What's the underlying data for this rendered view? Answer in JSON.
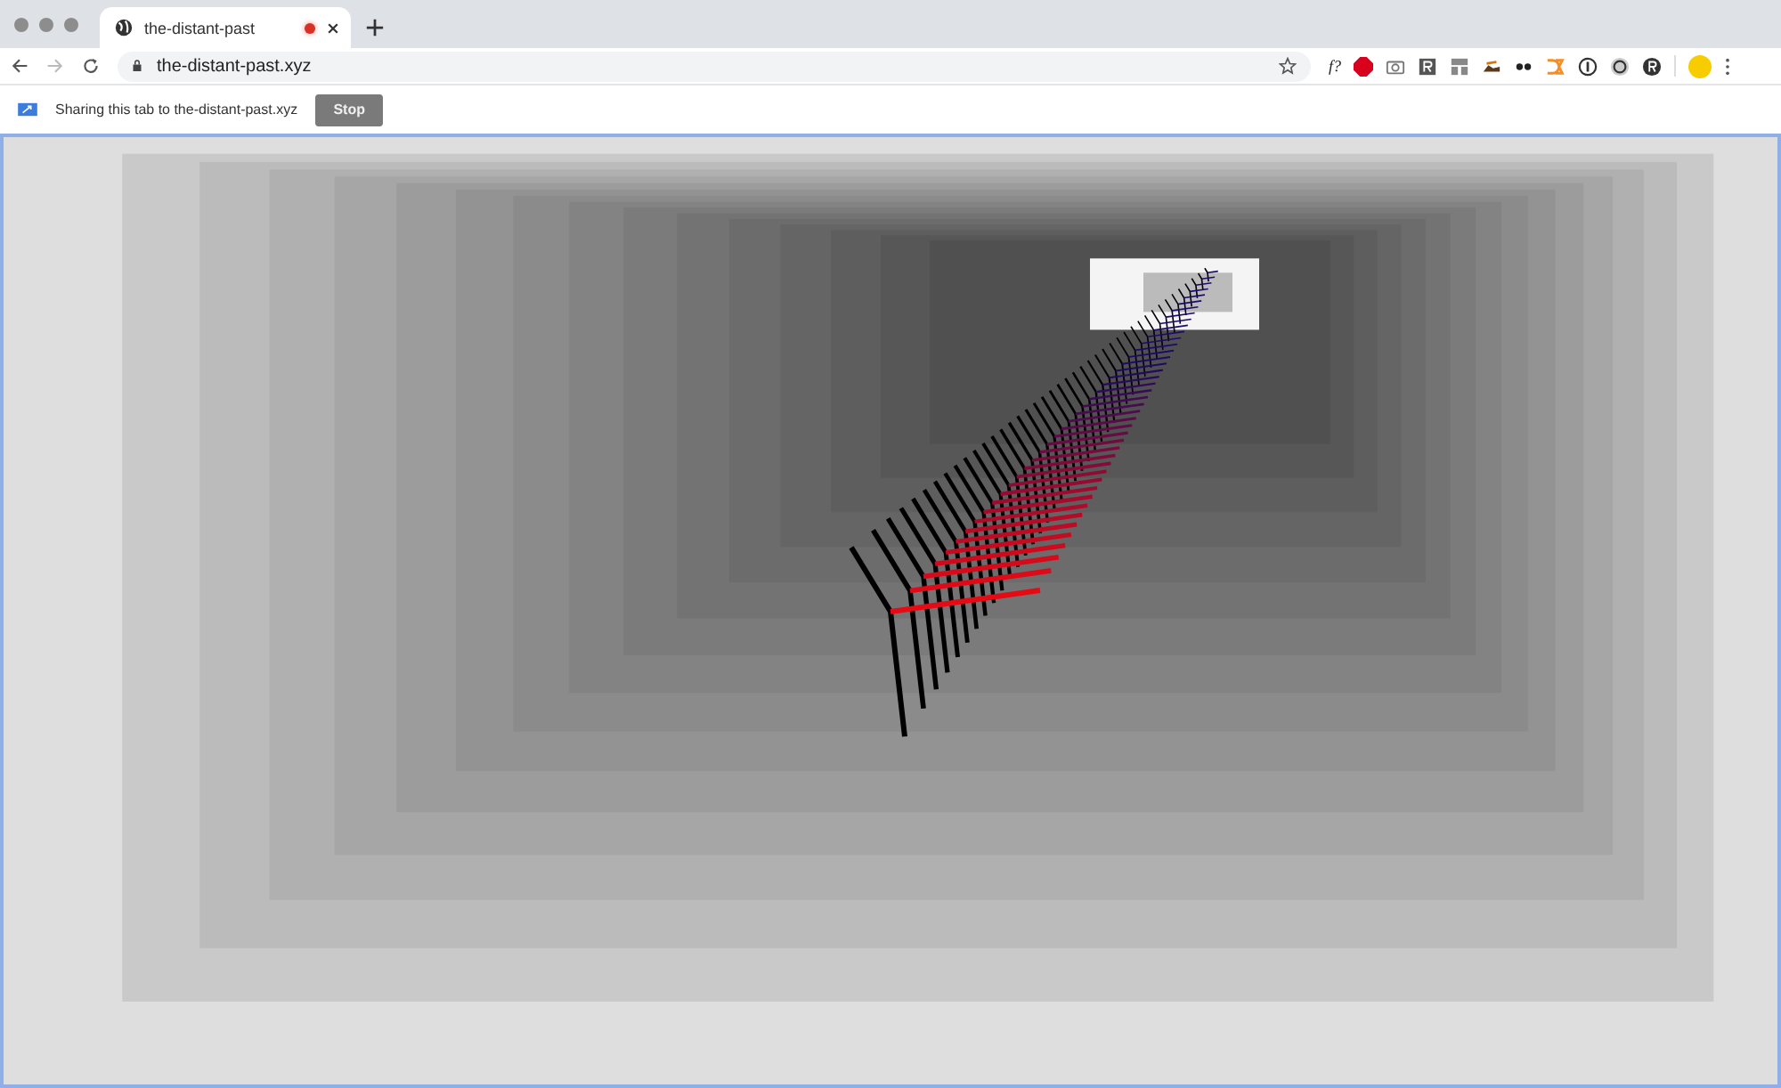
{
  "tab": {
    "title": "the-distant-past",
    "recording": true,
    "selected": true
  },
  "toolbar": {
    "url": "the-distant-past.xyz",
    "extension_label": "f?"
  },
  "infobar": {
    "message": "Sharing this tab to the-distant-past.xyz",
    "button": "Stop"
  }
}
